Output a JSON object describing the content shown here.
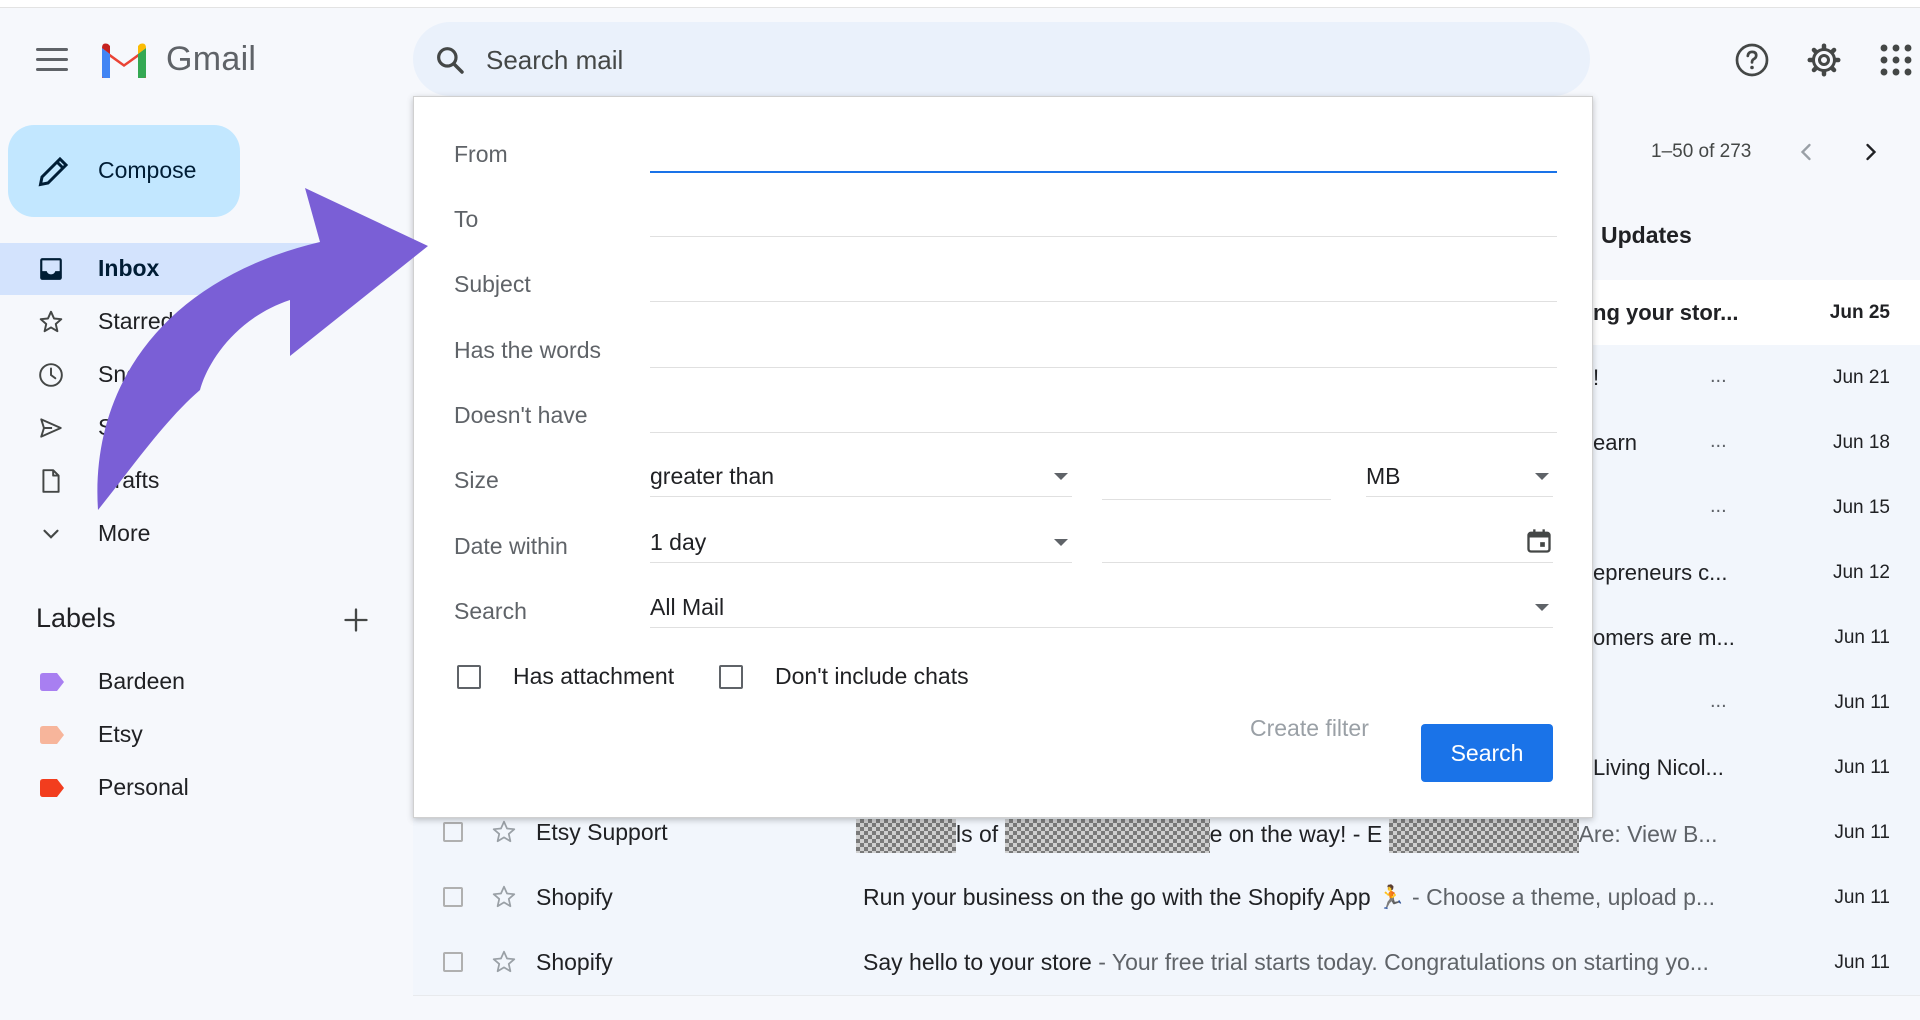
{
  "app": {
    "name": "Gmail"
  },
  "search": {
    "placeholder": "Search mail"
  },
  "sidebar": {
    "compose_label": "Compose",
    "items": [
      {
        "label": "Inbox",
        "icon": "inbox-icon",
        "active": true
      },
      {
        "label": "Starred",
        "icon": "star-icon"
      },
      {
        "label": "Snoozed",
        "icon": "clock-icon"
      },
      {
        "label": "Sent",
        "icon": "send-icon"
      },
      {
        "label": "Drafts",
        "icon": "draft-icon"
      },
      {
        "label": "More",
        "icon": "chevron-down-icon"
      }
    ],
    "labels_title": "Labels",
    "labels": [
      {
        "name": "Bardeen",
        "color": "#a87ff1"
      },
      {
        "name": "Etsy",
        "color": "#f7b59b"
      },
      {
        "name": "Personal",
        "color": "#f23d1e"
      }
    ]
  },
  "list": {
    "pager": "1–50 of 273",
    "tab_updates": "Updates",
    "rows_behind": [
      {
        "snippet": "ng your stor...",
        "dots": "",
        "date": "Jun 25",
        "unread": true
      },
      {
        "snippet": "!",
        "dots": "...",
        "date": "Jun 21"
      },
      {
        "snippet": "earn",
        "dots": "...",
        "date": "Jun 18"
      },
      {
        "snippet": "",
        "dots": "...",
        "date": "Jun 15"
      },
      {
        "snippet": "epreneurs c...",
        "dots": "",
        "date": "Jun 12"
      },
      {
        "snippet": "omers are m...",
        "dots": "",
        "date": "Jun 11"
      },
      {
        "snippet": "",
        "dots": "...",
        "date": "Jun 11"
      },
      {
        "snippet": "Living Nicol...",
        "dots": "",
        "date": "Jun 11"
      }
    ],
    "rows": [
      {
        "sender": "Etsy Support",
        "subject_parts": [
          "ls of",
          "e on the way! - E",
          "Are: View B..."
        ],
        "date": "Jun 11"
      },
      {
        "sender": "Shopify",
        "subject": "Run your business on the go with the Shopify App 🏃",
        "snippet": " - Choose a theme, upload p...",
        "date": "Jun 11"
      },
      {
        "sender": "Shopify",
        "subject": "Say hello to your store",
        "snippet": " - Your free trial starts today. Congratulations on starting yo...",
        "date": "Jun 11"
      }
    ]
  },
  "advanced": {
    "from_label": "From",
    "to_label": "To",
    "subject_label": "Subject",
    "has_words_label": "Has the words",
    "doesnt_have_label": "Doesn't have",
    "size_label": "Size",
    "size_operator": "greater than",
    "size_unit": "MB",
    "date_label": "Date within",
    "date_value": "1 day",
    "search_label": "Search",
    "search_scope": "All Mail",
    "has_attachment_label": "Has attachment",
    "no_chats_label": "Don't include chats",
    "create_filter_label": "Create filter",
    "search_button_label": "Search"
  },
  "colors": {
    "accent": "#1a73e8",
    "compose_bg": "#c2e7ff",
    "arrow": "#7a5fd6"
  }
}
